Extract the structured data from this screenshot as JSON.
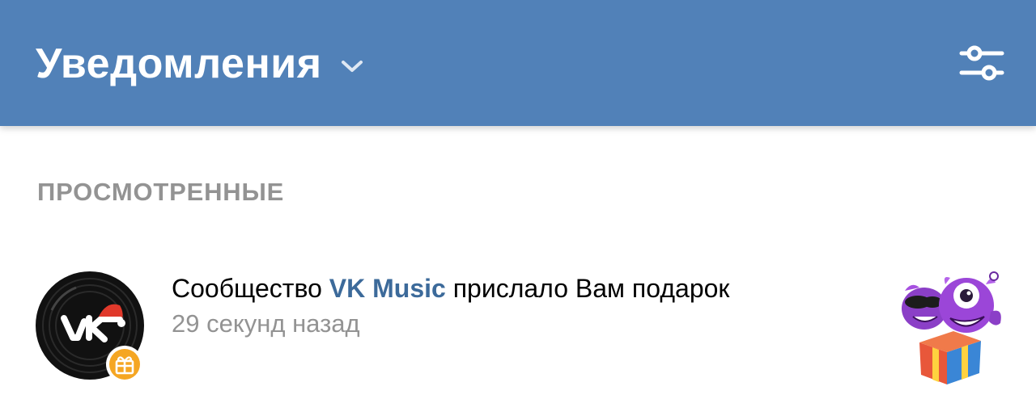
{
  "header": {
    "title": "Уведомления",
    "background_color": "#5181b8",
    "chevron_icon": "chevron-down-icon",
    "filter_icon": "sliders-icon"
  },
  "section": {
    "title": "ПРОСМОТРЕННЫЕ"
  },
  "notifications": [
    {
      "text_before": "Сообщество",
      "link_text": "VK Music",
      "text_after": "прислало Вам подарок",
      "time": "29 секунд назад",
      "avatar_icon": "vk-music-vinyl-avatar",
      "badge_icon": "gift-icon",
      "badge_color": "#f5a623",
      "preview": "gift-sticker-purple-monsters"
    }
  ]
}
